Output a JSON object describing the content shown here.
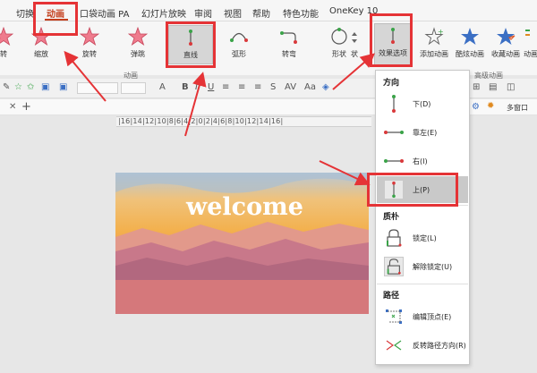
{
  "menubar": {
    "tabs": [
      "切换",
      "动画",
      "口袋动画 PA",
      "幻灯片放映",
      "审阅",
      "视图",
      "帮助",
      "特色功能",
      "OneKey 10"
    ],
    "active": "动画"
  },
  "ribbon": {
    "buttons": [
      {
        "label": "转"
      },
      {
        "label": "缩放"
      },
      {
        "label": "旋转"
      },
      {
        "label": "弹跳"
      },
      {
        "label": "直线"
      },
      {
        "label": "弧形"
      },
      {
        "label": "转弯"
      },
      {
        "label": "形状"
      },
      {
        "label": "状"
      },
      {
        "label": "效果选项"
      },
      {
        "label": "添加动画"
      },
      {
        "label": "酷炫动画"
      },
      {
        "label": "收藏动画"
      },
      {
        "label": "动画"
      }
    ],
    "group_label": "动画",
    "advanced_label": "高级动画"
  },
  "tabstrip": {
    "multi_window": "多窗口"
  },
  "ruler": {
    "text": "|16|14|12|10|8|6|4|2|0|2|4|6|8|10|12|14|16|"
  },
  "slide": {
    "title": "welcome"
  },
  "dropdown": {
    "section_direction": "方向",
    "items_direction": [
      {
        "label": "下(D)"
      },
      {
        "label": "靠左(E)"
      },
      {
        "label": "右(I)"
      },
      {
        "label": "上(P)"
      }
    ],
    "section_lock": "质朴",
    "items_lock": [
      {
        "label": "锁定(L)"
      },
      {
        "label": "解除锁定(U)"
      }
    ],
    "section_path": "路径",
    "items_path": [
      {
        "label": "编辑顶点(E)"
      },
      {
        "label": "反转路径方向(R)"
      }
    ]
  },
  "colors": {
    "accent": "#c43e1c",
    "highlight": "#e53336",
    "path_green": "#3aa348",
    "path_red": "#d9393b"
  }
}
